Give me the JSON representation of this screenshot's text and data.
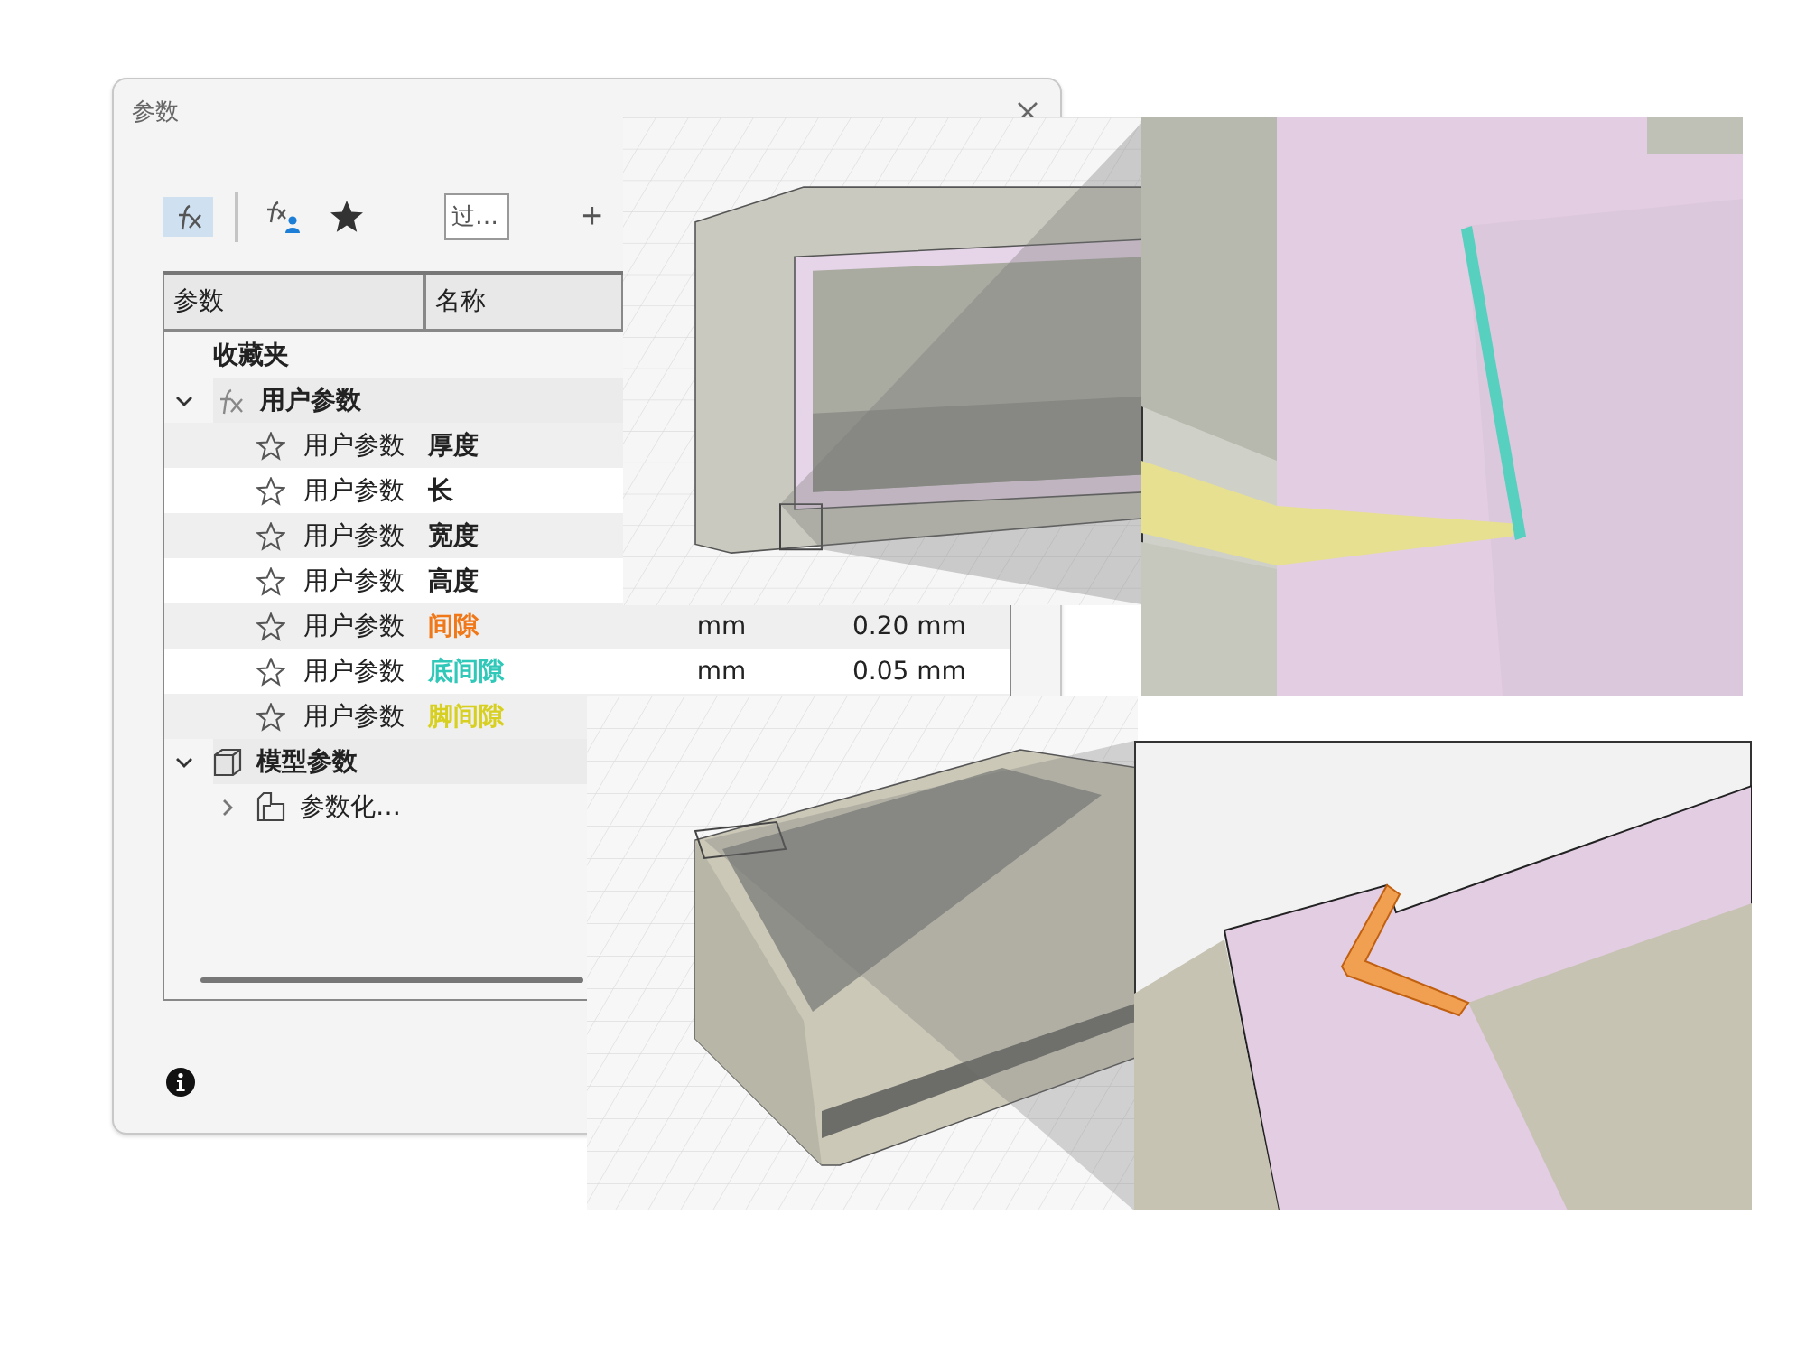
{
  "window": {
    "title": "参数"
  },
  "toolbar": {
    "items": [
      {
        "kind": "fx",
        "selected": true
      },
      {
        "kind": "fx-user",
        "selected": false
      },
      {
        "kind": "star",
        "selected": false
      }
    ],
    "filter": {
      "placeholder": "过…"
    },
    "add": "+"
  },
  "table": {
    "columns": [
      "参数",
      "名称"
    ],
    "rows": [
      {
        "kind": "favorites",
        "label": "收藏夹"
      },
      {
        "kind": "user-group",
        "label": "用户参数",
        "expanded": true,
        "children": [
          {
            "type": "用户参数",
            "name": "厚度",
            "favorite": false
          },
          {
            "type": "用户参数",
            "name": "长",
            "favorite": false
          },
          {
            "type": "用户参数",
            "name": "宽度",
            "favorite": false
          },
          {
            "type": "用户参数",
            "name": "高度",
            "favorite": false
          },
          {
            "type": "用户参数",
            "name": "间隙",
            "color": "#f07818",
            "favorite": false,
            "unit": "mm",
            "value": "0.20 mm"
          },
          {
            "type": "用户参数",
            "name": "底间隙",
            "color": "#30c8b8",
            "favorite": false,
            "unit": "mm",
            "value": "0.05 mm"
          },
          {
            "type": "用户参数",
            "name": "脚间隙",
            "color": "#d8d020",
            "favorite": false
          }
        ]
      },
      {
        "kind": "model-group",
        "label": "模型参数",
        "expanded": true,
        "children": [
          {
            "kind": "component",
            "label": "参数化…",
            "expanded": false
          }
        ]
      }
    ]
  }
}
